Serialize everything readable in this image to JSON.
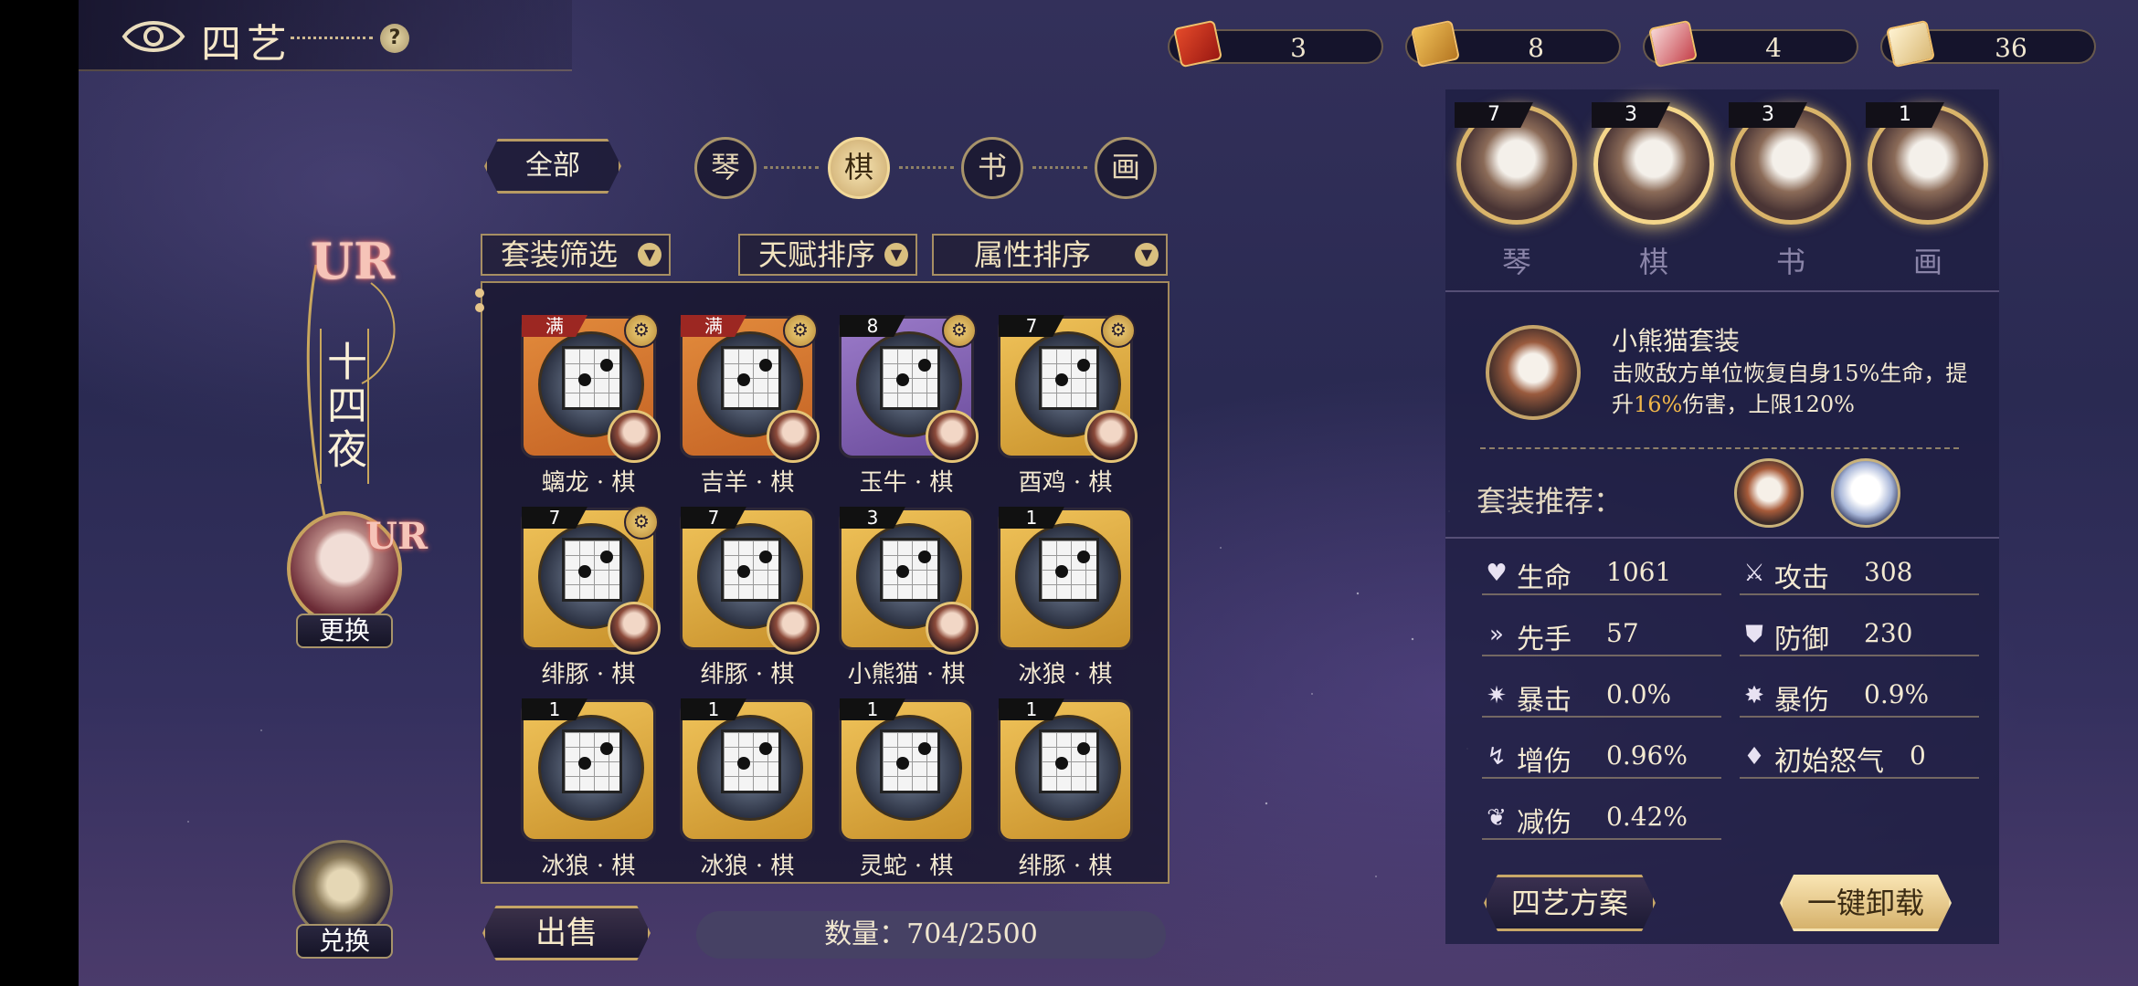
{
  "header": {
    "title": "四艺"
  },
  "resources": [
    {
      "value": "3"
    },
    {
      "value": "8"
    },
    {
      "value": "4"
    },
    {
      "value": "36"
    }
  ],
  "character": {
    "rarity": "UR",
    "name": "十四夜",
    "change_label": "更换",
    "exchange_label": "兑换"
  },
  "filters": {
    "all_label": "全部",
    "categories": [
      "琴",
      "棋",
      "书",
      "画"
    ],
    "active_category": "棋",
    "set_filter": "套装筛选",
    "talent_sort": "天赋排序",
    "attr_sort": "属性排序"
  },
  "items": [
    {
      "label": "螭龙 · 棋",
      "badge": "满",
      "frame": "orange"
    },
    {
      "label": "吉羊 · 棋",
      "badge": "满",
      "frame": "orange"
    },
    {
      "label": "玉牛 · 棋",
      "badge": "8",
      "frame": "purple"
    },
    {
      "label": "酉鸡 · 棋",
      "badge": "7",
      "frame": "gold"
    },
    {
      "label": "绯豚 · 棋",
      "badge": "7",
      "frame": "gold"
    },
    {
      "label": "绯豚 · 棋",
      "badge": "7",
      "frame": "gold"
    },
    {
      "label": "小熊猫 · 棋",
      "badge": "3",
      "frame": "gold"
    },
    {
      "label": "冰狼 · 棋",
      "badge": "1",
      "frame": "gold"
    },
    {
      "label": "冰狼 · 棋",
      "badge": "1",
      "frame": "gold"
    },
    {
      "label": "冰狼 · 棋",
      "badge": "1",
      "frame": "gold"
    },
    {
      "label": "灵蛇 · 棋",
      "badge": "1",
      "frame": "gold"
    },
    {
      "label": "绯豚 · 棋",
      "badge": "1",
      "frame": "gold"
    }
  ],
  "footer": {
    "sell_label": "出售",
    "count_text": "数量：704/2500"
  },
  "equipped": [
    {
      "label": "琴",
      "count": "7"
    },
    {
      "label": "棋",
      "count": "3"
    },
    {
      "label": "书",
      "count": "3"
    },
    {
      "label": "画",
      "count": "1"
    }
  ],
  "set_info": {
    "name": "小熊猫套装",
    "desc_part1": "击败敌方单位恢复自身15%生命，提升",
    "desc_highlight": "16%",
    "desc_part2": "伤害，上限120%"
  },
  "recommend_label": "套装推荐：",
  "stats": [
    {
      "label": "生命",
      "value": "1061",
      "icon": "heart-icon"
    },
    {
      "label": "攻击",
      "value": "308",
      "icon": "sword-icon"
    },
    {
      "label": "先手",
      "value": "57",
      "icon": "speed-icon"
    },
    {
      "label": "防御",
      "value": "230",
      "icon": "shield-icon"
    },
    {
      "label": "暴击",
      "value": "0.0%",
      "icon": "crit-icon"
    },
    {
      "label": "暴伤",
      "value": "0.9%",
      "icon": "crit-damage-icon"
    },
    {
      "label": "增伤",
      "value": "0.96%",
      "icon": "damage-boost-icon"
    },
    {
      "label": "初始怒气",
      "value": "0",
      "icon": "rage-icon"
    },
    {
      "label": "减伤",
      "value": "0.42%",
      "icon": "damage-reduction-icon"
    }
  ],
  "buttons": {
    "plan": "四艺方案",
    "unload_all": "一键卸载"
  },
  "colors": {
    "accent_gold": "#c9a75d",
    "highlight": "#f0b64a"
  }
}
